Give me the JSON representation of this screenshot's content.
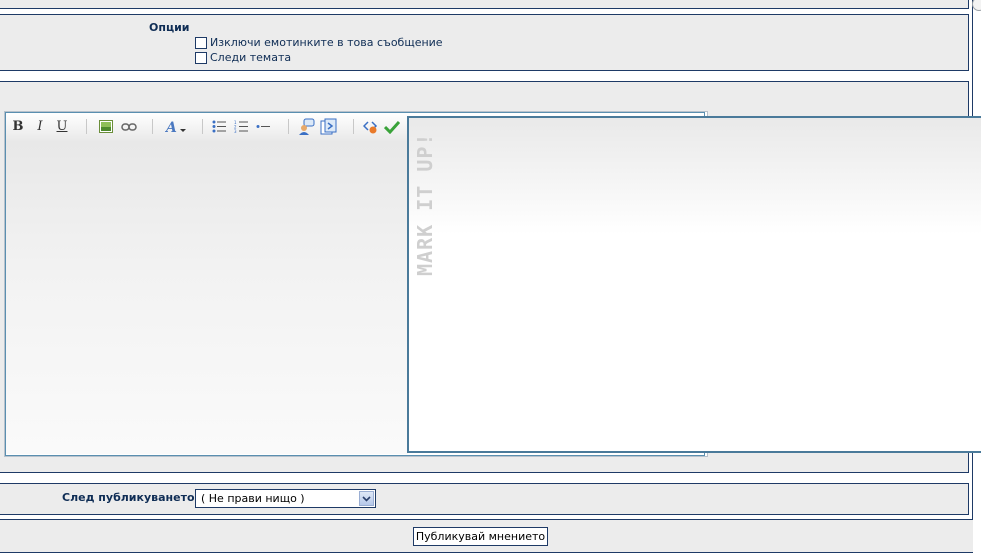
{
  "options": {
    "label": "Опции",
    "checkboxes": [
      {
        "label": "Изключи емотинките в това съобщение",
        "checked": false
      },
      {
        "label": "Следи темата",
        "checked": false
      }
    ]
  },
  "toolbar": {
    "bold_label": "B",
    "italic_label": "I",
    "underline_label": "U",
    "icons": [
      "bold-icon",
      "italic-icon",
      "underline-icon",
      "image-icon",
      "link-icon",
      "font-color-icon",
      "bullet-list-icon",
      "numbered-list-icon",
      "list-item-icon",
      "quote-icon",
      "code-icon",
      "preview-icon",
      "check-icon"
    ]
  },
  "preview": {
    "watermark": "MARK IT UP!"
  },
  "after_post": {
    "label": "След публикуването",
    "selected": "( Не прави нищо )"
  },
  "submit": {
    "label": "Публикувай мнението"
  },
  "colors": {
    "border": "#1e3a66",
    "panel": "#ececec",
    "preview_border": "#4a7a9a",
    "label_text": "#0f2d55"
  }
}
